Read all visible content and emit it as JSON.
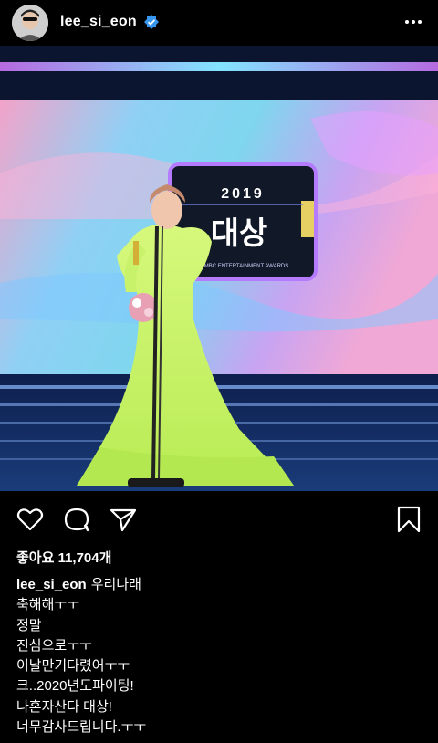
{
  "header": {
    "username": "lee_si_eon",
    "verified": true,
    "avatar_icon": "avatar-photo",
    "more_icon": "more-horizontal-icon"
  },
  "post_image": {
    "screen_year": "2019",
    "screen_title": "대상",
    "screen_subtitle": "MBC ENTERTAINMENT AWARDS"
  },
  "actions": {
    "like_icon": "heart-icon",
    "comment_icon": "comment-icon",
    "share_icon": "share-icon",
    "save_icon": "bookmark-icon"
  },
  "likes": {
    "label": "좋아요 11,704개"
  },
  "caption": {
    "username": "lee_si_eon",
    "first_line": "우리나래",
    "lines": [
      "축해해ㅜㅜ",
      "정말",
      "진심으로ㅜㅜ",
      "이날만기다렸어ㅜㅜ",
      "크..2020년도파이팅!",
      "나혼자산다 대상!",
      "너무감사드립니다.ㅜㅜ"
    ]
  },
  "colors": {
    "background": "#000000",
    "text": "#ffffff",
    "verified_badge": "#3897f0",
    "dress": "#c8f26a"
  }
}
